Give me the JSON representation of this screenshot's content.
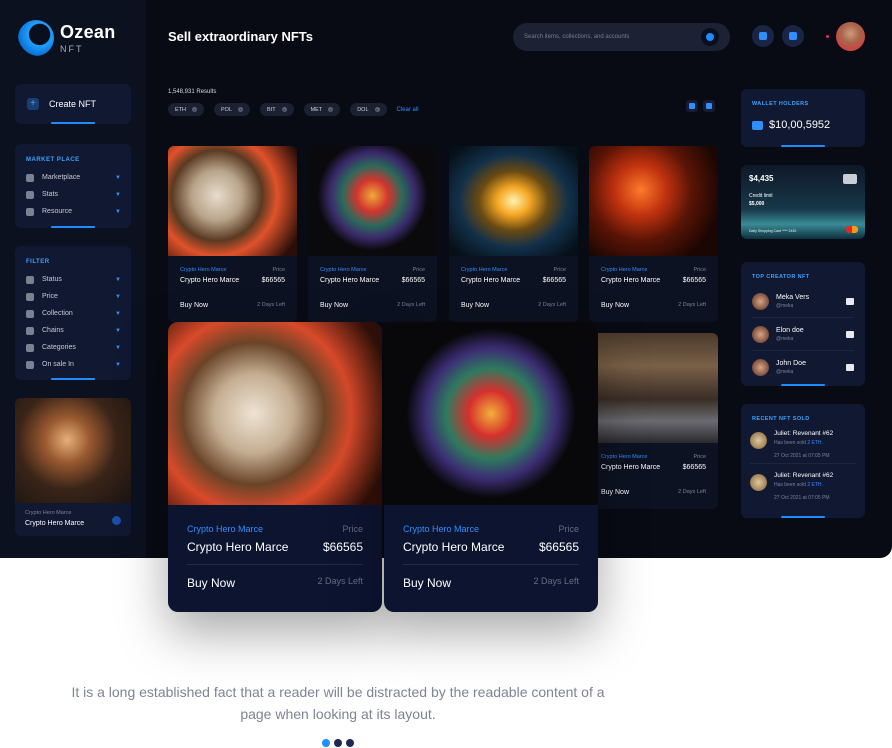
{
  "brand": {
    "name": "Ozean",
    "sub": "NFT"
  },
  "header": {
    "title": "Sell extraordinary NFTs",
    "search_placeholder": "Search items, collections, and accounts"
  },
  "sidebar": {
    "create_label": "Create NFT",
    "marketplace_title": "MARKET PLACE",
    "marketplace_items": [
      "Marketplace",
      "Stats",
      "Resource"
    ],
    "filter_title": "FILTER",
    "filter_items": [
      "Status",
      "Price",
      "Collection",
      "Chains",
      "Categories",
      "On sale In"
    ],
    "featured": {
      "subtitle": "Crypto Hero Marce",
      "title": "Crypto Hero Marce"
    }
  },
  "results": {
    "count_text": "1,548,931 Results",
    "chips": [
      "ETH",
      "POL",
      "BIT",
      "MET",
      "DOL"
    ],
    "clear_label": "Clear all"
  },
  "card": {
    "creator": "Crypto Hero Marce",
    "price_label": "Price",
    "name": "Crypto Hero Marce",
    "price": "$66565",
    "buy_label": "Buy Now",
    "time_left": "2 Days Left"
  },
  "wallet": {
    "title": "WALLET HOLDERS",
    "amount": "$10,00,5952"
  },
  "credit_card": {
    "balance": "$4,435",
    "limit_label": "Credit limit",
    "limit_value": "$5,000",
    "footer": "Daily Shopping Card **** 2430"
  },
  "top_creators": {
    "title": "TOP CREATOR NFT",
    "items": [
      {
        "name": "Meka Vers",
        "handle": "@meka"
      },
      {
        "name": "Elon doe",
        "handle": "@meka"
      },
      {
        "name": "John Doe",
        "handle": "@meka"
      }
    ]
  },
  "recent_sold": {
    "title": "RECENT NFT SOLD",
    "items": [
      {
        "title": "Juliet: Revenant #62",
        "desc": "Has been sold",
        "amount": "2 ETH.",
        "time": "27 Oct 2021 at 07:05 PM"
      },
      {
        "title": "Juliet: Revenant #62",
        "desc": "Has been sold",
        "amount": "2 ETH.",
        "time": "27 Oct 2021 at 07:05 PM"
      }
    ]
  },
  "caption": "It is a long established fact that a reader will be distracted by the readable content of a page when looking at its layout.",
  "carousel": {
    "count": 3,
    "active": 0
  },
  "colors": {
    "accent": "#1e8dff",
    "background": "#080b14",
    "panel": "#111831"
  },
  "icons": {
    "marketplace": "grid-icon",
    "search": "search-icon",
    "notification": "bell-icon",
    "wallet": "wallet-icon",
    "message": "message-icon"
  }
}
